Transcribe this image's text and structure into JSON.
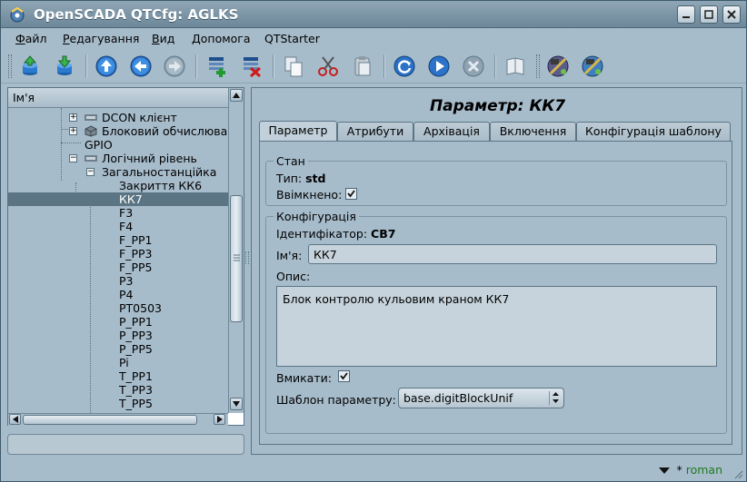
{
  "window": {
    "title": "OpenSCADA QTCfg: AGLKS"
  },
  "menu": [
    {
      "label": "Файл",
      "u": "Ф",
      "rest": "айл"
    },
    {
      "label": "Редагування",
      "u": "Р",
      "rest": "едагування"
    },
    {
      "label": "Вид",
      "u": "В",
      "rest": "ид"
    },
    {
      "label": "Допомога",
      "u": "Д",
      "rest": "опомога"
    },
    {
      "label": "QTStarter",
      "u": "",
      "rest": "QTStarter"
    }
  ],
  "toolbar": {
    "icons": [
      "db-load-icon",
      "db-save-icon",
      "up-icon",
      "back-icon",
      "forward-icon",
      "add-item-icon",
      "delete-item-icon",
      "copy-icon",
      "cut-icon",
      "paste-icon",
      "refresh-icon",
      "start-icon",
      "stop-icon",
      "manual-icon",
      "module-config-icon",
      "module-tools-icon"
    ]
  },
  "tree": {
    "header": "Ім'я",
    "rows": [
      {
        "label": "DCON клієнт",
        "level": 2
      },
      {
        "label": "Блоковий обчислювач",
        "level": 2
      },
      {
        "label": "GPIO",
        "level": 2
      },
      {
        "label": "Логічний рівень",
        "level": 2
      },
      {
        "label": "Загальностанційка",
        "level": 3
      },
      {
        "label": "Закриття КК6",
        "level": 4
      },
      {
        "label": "КК7",
        "level": 4,
        "selected": true
      },
      {
        "label": "F3",
        "level": 4
      },
      {
        "label": "F4",
        "level": 4
      },
      {
        "label": "F_PP1",
        "level": 4
      },
      {
        "label": "F_PP3",
        "level": 4
      },
      {
        "label": "F_PP5",
        "level": 4
      },
      {
        "label": "P3",
        "level": 4
      },
      {
        "label": "P4",
        "level": 4
      },
      {
        "label": "PT0503",
        "level": 4
      },
      {
        "label": "P_PP1",
        "level": 4
      },
      {
        "label": "P_PP3",
        "level": 4
      },
      {
        "label": "P_PP5",
        "level": 4
      },
      {
        "label": "Pi",
        "level": 4
      },
      {
        "label": "T_PP1",
        "level": 4
      },
      {
        "label": "T_PP3",
        "level": 4
      },
      {
        "label": "T_PP5",
        "level": 4
      }
    ]
  },
  "page": {
    "title": "Параметр: КК7",
    "tabs": [
      "Параметр",
      "Атрибути",
      "Архівація",
      "Включення",
      "Конфігурація шаблону"
    ],
    "active_tab": 0,
    "state": {
      "title": "Стан",
      "type_label": "Тип:",
      "type_value": "std",
      "enabled_label": "Ввімкнено:",
      "enabled": true
    },
    "config": {
      "title": "Конфігурація",
      "id_label": "Ідентифікатор:",
      "id_value": "CB7",
      "name_label": "Ім'я:",
      "name_value": "КК7",
      "descr_label": "Опис:",
      "descr_value": "Блок контролю кульовим краном КК7",
      "enable_label": "Вмикати:",
      "enable": true,
      "template_label": "Шаблон параметру:",
      "template_value": "base.digitBlockUnif"
    }
  },
  "status": {
    "mark": "*",
    "user": "roman"
  }
}
